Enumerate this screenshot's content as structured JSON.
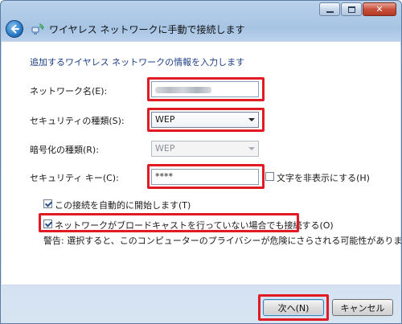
{
  "window": {
    "title": "ワイヤレス ネットワークに手動で接続します"
  },
  "form": {
    "instruction": "追加するワイヤレス ネットワークの情報を入力します",
    "network_name_label": "ネットワーク名(E):",
    "network_name_value": "",
    "security_type_label": "セキュリティの種類(S):",
    "security_type_value": "WEP",
    "encryption_type_label": "暗号化の種類(R):",
    "encryption_type_value": "WEP",
    "security_key_label": "セキュリティ キー(C):",
    "security_key_value": "****",
    "hide_chars_label": "文字を非表示にする(H)",
    "hide_chars_checked": false,
    "auto_start_label": "この接続を自動的に開始します(T)",
    "auto_start_checked": true,
    "connect_hidden_label": "ネットワークがブロードキャストを行っていない場合でも接続する(O)",
    "connect_hidden_checked": true,
    "warning": "警告: 選択すると、このコンピューターのプライバシーが危険にさらされる可能性があります。"
  },
  "buttons": {
    "next": "次へ(N)",
    "cancel": "キャンセル"
  },
  "colors": {
    "highlight": "#e01b24",
    "instruction_text": "#1e3f86"
  },
  "icons": {
    "back": "back-arrow-icon",
    "network": "wireless-network-icon",
    "minimize": "minimize-icon",
    "maximize": "maximize-icon",
    "close": "close-icon"
  }
}
